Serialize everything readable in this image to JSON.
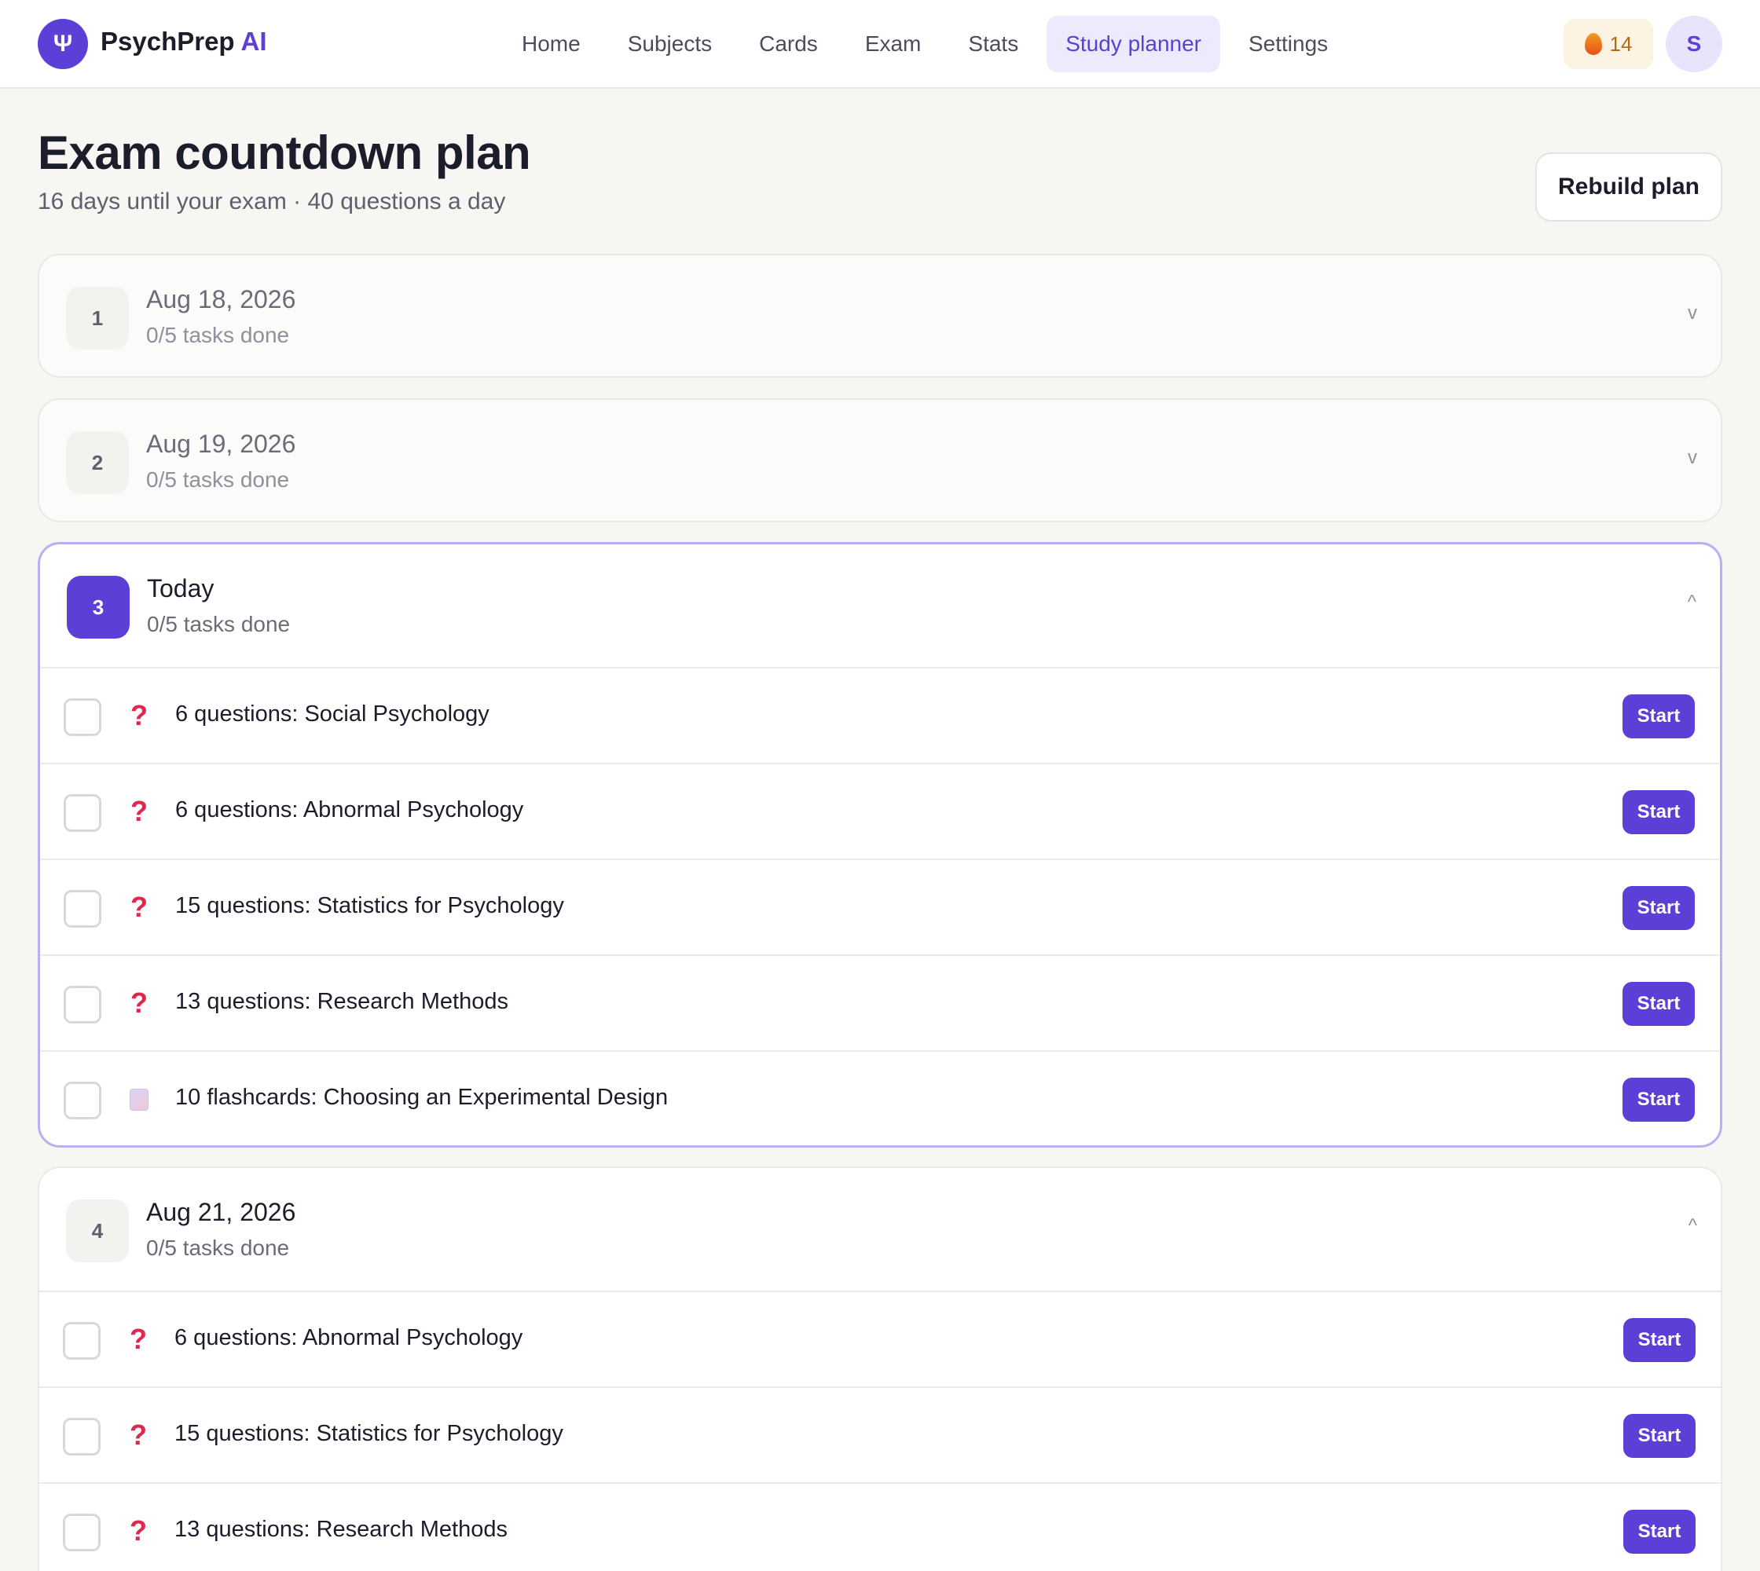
{
  "brand": {
    "icon": "Ψ",
    "name": "PsychPrep",
    "accent": "AI",
    "color": "#5b3fd6"
  },
  "nav": [
    {
      "label": "Home"
    },
    {
      "label": "Subjects"
    },
    {
      "label": "Cards"
    },
    {
      "label": "Exam"
    },
    {
      "label": "Stats"
    },
    {
      "label": "Study planner",
      "active": true
    },
    {
      "label": "Settings"
    }
  ],
  "streak": {
    "count": "14",
    "icon": "flame-icon"
  },
  "user": {
    "initial": "S"
  },
  "page": {
    "title": "Exam countdown plan",
    "subtitle": "16 days until your exam · 40 questions a day",
    "rebuild_label": "Rebuild plan"
  },
  "days": [
    {
      "number": "1",
      "date": "Aug 18, 2026",
      "progress": "0/5 tasks done",
      "chevron": "v",
      "state": "past",
      "tasks": []
    },
    {
      "number": "2",
      "date": "Aug 19, 2026",
      "progress": "0/5 tasks done",
      "chevron": "v",
      "state": "past",
      "tasks": []
    },
    {
      "number": "3",
      "date": "Today",
      "progress": "0/5 tasks done",
      "chevron": "^",
      "state": "today",
      "tasks": [
        {
          "icon": "?",
          "type": "question",
          "label": "6 questions: Social Psychology",
          "action": "Start"
        },
        {
          "icon": "?",
          "type": "question",
          "label": "6 questions: Abnormal Psychology",
          "action": "Start"
        },
        {
          "icon": "?",
          "type": "question",
          "label": "15 questions: Statistics for Psychology",
          "action": "Start"
        },
        {
          "icon": "?",
          "type": "question",
          "label": "13 questions: Research Methods",
          "action": "Start"
        },
        {
          "icon": "",
          "type": "flashcard",
          "label": "10 flashcards: Choosing an Experimental Design",
          "action": "Start"
        }
      ]
    },
    {
      "number": "4",
      "date": "Aug 21, 2026",
      "progress": "0/5 tasks done",
      "chevron": "^",
      "state": "upcoming",
      "tasks": [
        {
          "icon": "?",
          "type": "question",
          "label": "6 questions: Abnormal Psychology",
          "action": "Start"
        },
        {
          "icon": "?",
          "type": "question",
          "label": "15 questions: Statistics for Psychology",
          "action": "Start"
        },
        {
          "icon": "?",
          "type": "question",
          "label": "13 questions: Research Methods",
          "action": "Start"
        }
      ]
    }
  ]
}
